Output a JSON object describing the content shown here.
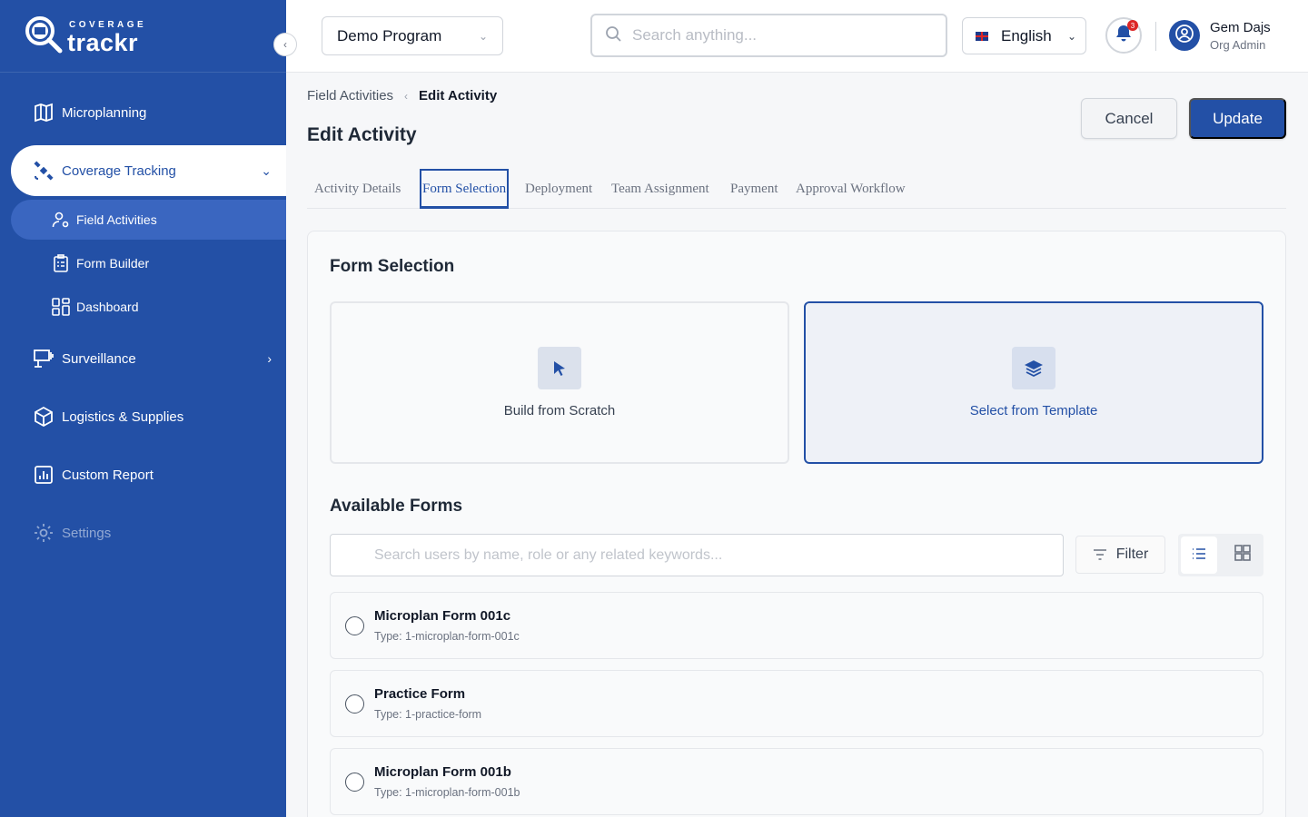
{
  "brand": {
    "small": "COVERAGE",
    "big": "trackr"
  },
  "sidebar": {
    "items": [
      {
        "label": "Microplanning"
      },
      {
        "label": "Coverage Tracking"
      },
      {
        "label": "Field Activities"
      },
      {
        "label": "Form Builder"
      },
      {
        "label": "Dashboard"
      },
      {
        "label": "Surveillance"
      },
      {
        "label": "Logistics & Supplies"
      },
      {
        "label": "Custom Report"
      },
      {
        "label": "Settings"
      }
    ]
  },
  "header": {
    "program": "Demo Program",
    "search_placeholder": "Search anything...",
    "language": "English",
    "notification_count": "3",
    "user_name": "Gem Dajs",
    "user_role": "Org Admin"
  },
  "breadcrumb": {
    "parent": "Field Activities",
    "current": "Edit Activity"
  },
  "page": {
    "title": "Edit Activity",
    "cancel_label": "Cancel",
    "update_label": "Update"
  },
  "tabs": [
    {
      "label": "Activity Details"
    },
    {
      "label": "Form Selection"
    },
    {
      "label": "Deployment"
    },
    {
      "label": "Team Assignment"
    },
    {
      "label": "Payment"
    },
    {
      "label": "Approval Workflow"
    }
  ],
  "form_selection": {
    "title": "Form Selection",
    "option_scratch": "Build from Scratch",
    "option_template": "Select from Template"
  },
  "available_forms": {
    "title": "Available Forms",
    "search_placeholder": "Search users by name, role or any related keywords...",
    "filter_label": "Filter",
    "items": [
      {
        "name": "Microplan Form 001c",
        "type": "Type: 1-microplan-form-001c"
      },
      {
        "name": "Practice Form",
        "type": "Type: 1-practice-form"
      },
      {
        "name": "Microplan Form 001b",
        "type": "Type: 1-microplan-form-001b"
      }
    ]
  },
  "colors": {
    "brand": "#2350a6",
    "danger": "#dc2626"
  }
}
